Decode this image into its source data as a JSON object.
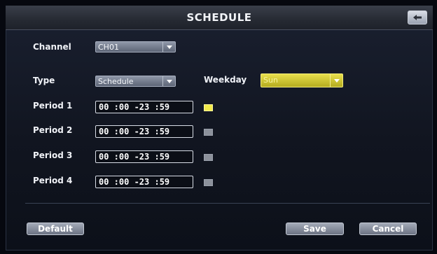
{
  "header": {
    "title": "SCHEDULE",
    "back_icon": "back-arrow-icon"
  },
  "channel": {
    "label": "Channel",
    "value": "CH01"
  },
  "type": {
    "label": "Type",
    "value": "Schedule"
  },
  "weekday": {
    "label": "Weekday",
    "value": "Sun"
  },
  "periods": [
    {
      "label": "Period 1",
      "time": "00 :00 -23 :59",
      "enabled": true
    },
    {
      "label": "Period 2",
      "time": "00 :00 -23 :59",
      "enabled": false
    },
    {
      "label": "Period 3",
      "time": "00 :00 -23 :59",
      "enabled": false
    },
    {
      "label": "Period 4",
      "time": "00 :00 -23 :59",
      "enabled": false
    }
  ],
  "buttons": {
    "default": "Default",
    "save": "Save",
    "cancel": "Cancel"
  },
  "colors": {
    "accent": "#e8df4c",
    "panel": "#151a26"
  }
}
